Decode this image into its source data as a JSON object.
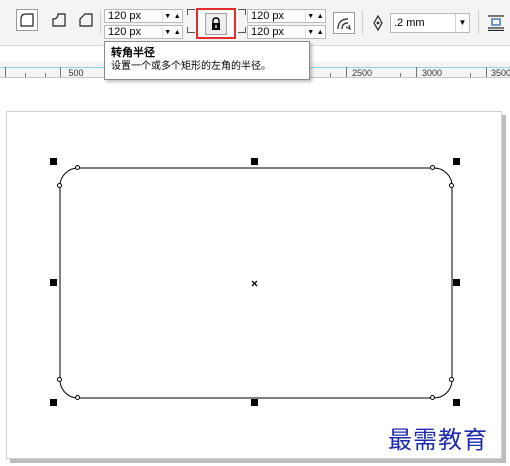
{
  "toolbar": {
    "corner_buttons": [
      "round-corner-icon",
      "scalloped-corner-icon",
      "chamfered-corner-icon"
    ],
    "corner_radius": {
      "top_left": "120 px",
      "bottom_left": "120 px",
      "top_right": "120 px",
      "bottom_right": "120 px"
    },
    "lock_icon": "lock-icon",
    "relative_scaling_icon": "relative-corner-scaling-icon",
    "outline_pen_icon": "pen-nib-icon",
    "outline_width": ".2 mm",
    "wrap_icon": "text-wrap-icon"
  },
  "tooltip": {
    "title": "转角半径",
    "description": "设置一个或多个矩形的左角的半径。"
  },
  "ruler": {
    "labels": [
      "500",
      "2500",
      "3000",
      "3500"
    ]
  },
  "watermark": "最需教育",
  "colors": {
    "highlight_border": "#e22e2e",
    "ruler_line": "#8fd3e6",
    "watermark": "#1e2bb0"
  }
}
